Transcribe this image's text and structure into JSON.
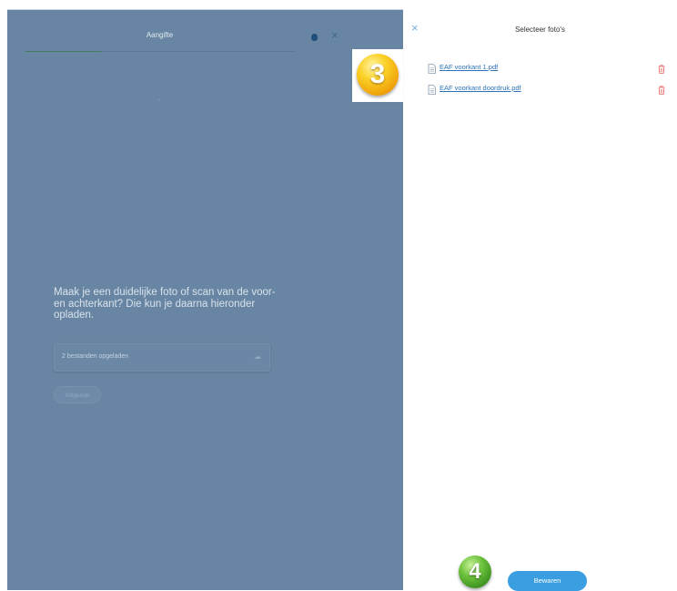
{
  "app": {
    "title": "Aangifte",
    "progress_fraction": 0.28,
    "instruction": "Maak je een duidelijke foto of scan van de voor- en achterkant? Die kun je daarna hieronder opladen.",
    "upload": {
      "status": "2 bestanden opgeladen",
      "icon": "cloud-upload-icon"
    },
    "next_label": "Volgende"
  },
  "panel": {
    "title": "Selecteer foto's",
    "files": [
      {
        "name": "EAF voorkant 1.pdf"
      },
      {
        "name": "EAF voorkant doordruk.pdf"
      }
    ],
    "save_label": "Bewaren"
  },
  "badges": {
    "step3": "3",
    "step4": "4"
  },
  "colors": {
    "overlay": "#6886a3",
    "link": "#2e72b8",
    "delete": "#e4605c",
    "save_button": "#3a9ee0",
    "badge_3": "#f5b71a",
    "badge_4": "#52a82e"
  }
}
